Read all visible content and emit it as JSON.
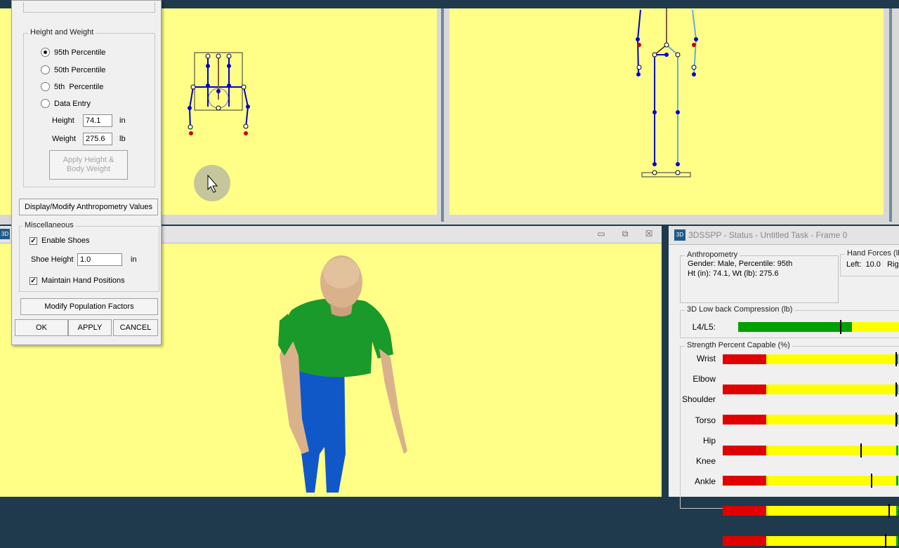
{
  "dialog": {
    "height_weight_legend": "Height and Weight",
    "radio_95": "95th Percentile",
    "radio_50": "50th Percentile",
    "radio_5": "5th  Percentile",
    "radio_data": "Data Entry",
    "height_label": "Height",
    "height_value": "74.1",
    "height_unit": "in",
    "weight_label": "Weight",
    "weight_value": "275.6",
    "weight_unit": "lb",
    "apply_hw_label": "Apply Height & Body Weight",
    "display_modify_label": "Display/Modify Anthropometry Values",
    "misc_legend": "Miscellaneous",
    "enable_shoes_label": "Enable Shoes",
    "shoe_height_label": "Shoe Height",
    "shoe_height_value": "1.0",
    "shoe_height_unit": "in",
    "maintain_hand_label": "Maintain Hand Positions",
    "modify_pop_label": "Modify Population Factors",
    "ok_label": "OK",
    "apply_label": "APPLY",
    "cancel_label": "CANCEL"
  },
  "status": {
    "title": "3DSSPP - Status - Untitled Task - Frame 0",
    "anthropometry_legend": "Anthropometry",
    "gender_line": "Gender: Male, Percentile: 95th",
    "ht_wt_line": "Ht (in): 74.1, Wt (lb): 275.6",
    "hand_forces_legend": "Hand Forces (lb",
    "hand_left": "Left:  10.0   Rig",
    "lowback_legend": "3D Low back Compression (lb)",
    "l4l5_label": "L4/L5:",
    "l4l5_green_fraction": 0.66,
    "l4l5_marker_fraction": 0.59,
    "strength_legend": "Strength Percent Capable (%)",
    "strength": [
      {
        "joint": "Wrist",
        "marker": 0.99
      },
      {
        "joint": "Elbow",
        "marker": 0.99
      },
      {
        "joint": "Shoulder",
        "marker": 0.99
      },
      {
        "joint": "Torso",
        "marker": 0.79
      },
      {
        "joint": "Hip",
        "marker": 0.85
      },
      {
        "joint": "Knee",
        "marker": 0.95
      },
      {
        "joint": "Ankle",
        "marker": 0.93
      }
    ]
  },
  "icons": {
    "app_icon": "3D",
    "minimize": "▭",
    "maximize": "⧉",
    "close": "☒"
  },
  "colors": {
    "viewport": "#ffff88",
    "bar_red": "#e00000",
    "bar_yellow": "#ffff00",
    "bar_green": "#00a000",
    "skeleton_blue": "#0000cc",
    "skeleton_red": "#cc0000",
    "shirt": "#1a9a2a",
    "pants": "#1058c8"
  }
}
